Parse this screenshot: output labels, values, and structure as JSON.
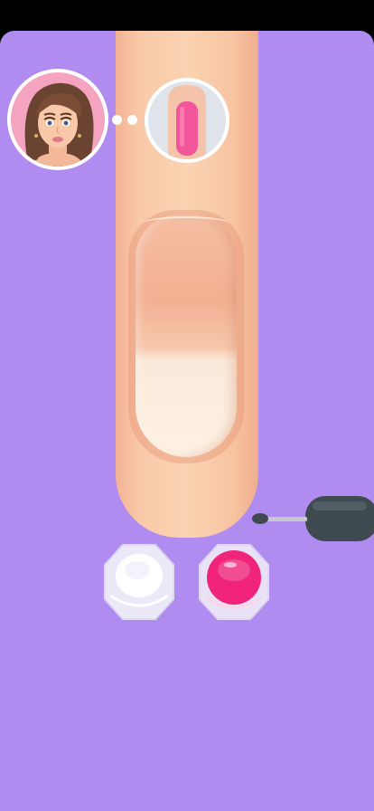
{
  "colors": {
    "background": "#b08cf0",
    "skin": "#f9caa9",
    "nail_tip": "#fdf1e3",
    "target_polish": "#f2559a"
  },
  "reference": {
    "avatar": "woman-avatar-icon",
    "target": "pink-nail-icon"
  },
  "polishes": [
    {
      "name": "white",
      "color": "#ffffff"
    },
    {
      "name": "pink",
      "color": "#f0247a"
    }
  ],
  "tool": "nail-polish-brush-icon"
}
